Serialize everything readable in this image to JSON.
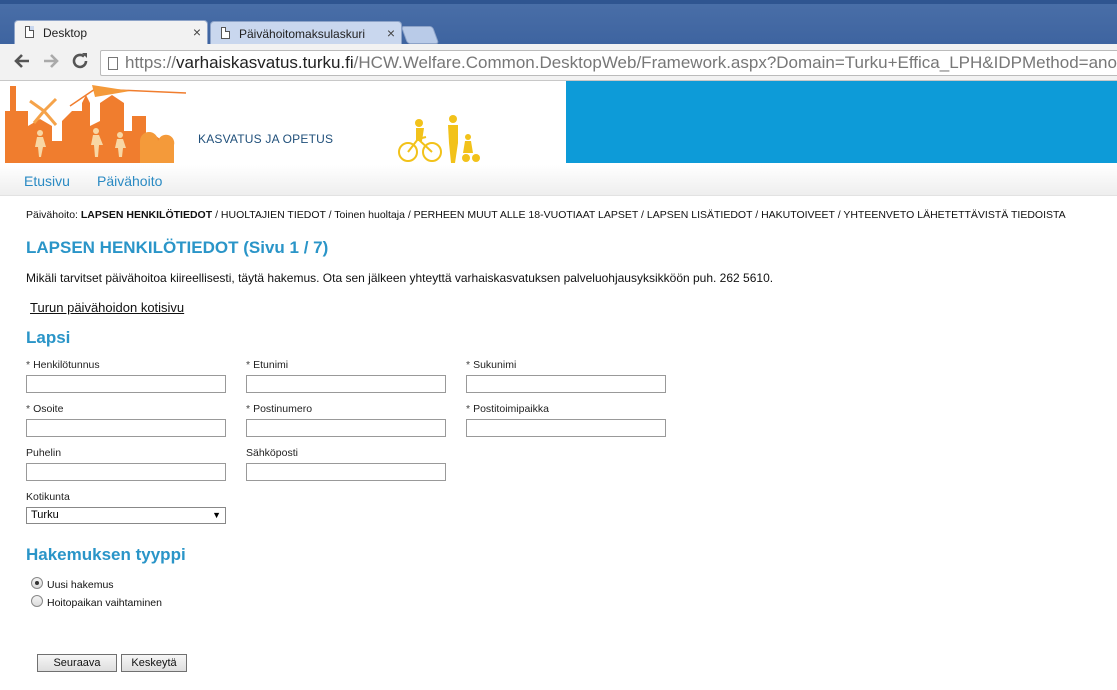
{
  "browser": {
    "tabs": [
      {
        "title": "Desktop",
        "close": "×"
      },
      {
        "title": "Päivähoitomaksulaskuri",
        "close": "×"
      }
    ],
    "url": {
      "scheme": "https://",
      "host": "varhaiskasvatus.turku.fi",
      "path": "/HCW.Welfare.Common.DesktopWeb/Framework.aspx?Domain=Turku+Effica_LPH&IDPMethod=anonymous&"
    },
    "icons": {
      "back": "back-arrow-icon",
      "forward": "forward-arrow-icon",
      "reload": "reload-icon"
    }
  },
  "header": {
    "brand": "KASVATUS JA OPETUS",
    "accent_color": "#0d9bd8",
    "art_color": "#f07d2e",
    "figure_color": "#f2c21a"
  },
  "nav": {
    "items": [
      "Etusivu",
      "Päivähoito"
    ]
  },
  "breadcrumb": {
    "prefix": "Päivähoito:",
    "current": "LAPSEN HENKILÖTIEDOT",
    "rest": "/ HUOLTAJIEN TIEDOT / Toinen huoltaja / PERHEEN MUUT ALLE 18-VUOTIAAT LAPSET / LAPSEN LISÄTIEDOT / HAKUTOIVEET / YHTEENVETO LÄHETETTÄVISTÄ TIEDOISTA"
  },
  "page": {
    "title": "LAPSEN HENKILÖTIEDOT (Sivu 1 / 7)",
    "info": "Mikäli tarvitset päivähoitoa kiireellisesti, täytä hakemus. Ota sen jälkeen yhteyttä varhaiskasvatuksen palveluohjausyksikköön puh. 262 5610.",
    "home_link": "Turun päivähoidon kotisivu"
  },
  "form": {
    "section_title": "Lapsi",
    "required_marker": "*",
    "fields": {
      "henkilotunnus": {
        "label": "Henkilötunnus",
        "value": ""
      },
      "etunimi": {
        "label": "Etunimi",
        "value": ""
      },
      "sukunimi": {
        "label": "Sukunimi",
        "value": ""
      },
      "osoite": {
        "label": "Osoite",
        "value": ""
      },
      "postinumero": {
        "label": "Postinumero",
        "value": ""
      },
      "postitoimipaikka": {
        "label": "Postitoimipaikka",
        "value": ""
      },
      "puhelin": {
        "label": "Puhelin",
        "value": ""
      },
      "sahkoposti": {
        "label": "Sähköposti",
        "value": ""
      }
    },
    "kotikunta": {
      "label": "Kotikunta",
      "selected": "Turku",
      "arrow": "▼"
    }
  },
  "application_type": {
    "section_title": "Hakemuksen tyyppi",
    "options": [
      {
        "label": "Uusi hakemus",
        "checked": true
      },
      {
        "label": "Hoitopaikan vaihtaminen",
        "checked": false
      }
    ]
  },
  "buttons": {
    "next": "Seuraava",
    "cancel": "Keskeytä"
  }
}
